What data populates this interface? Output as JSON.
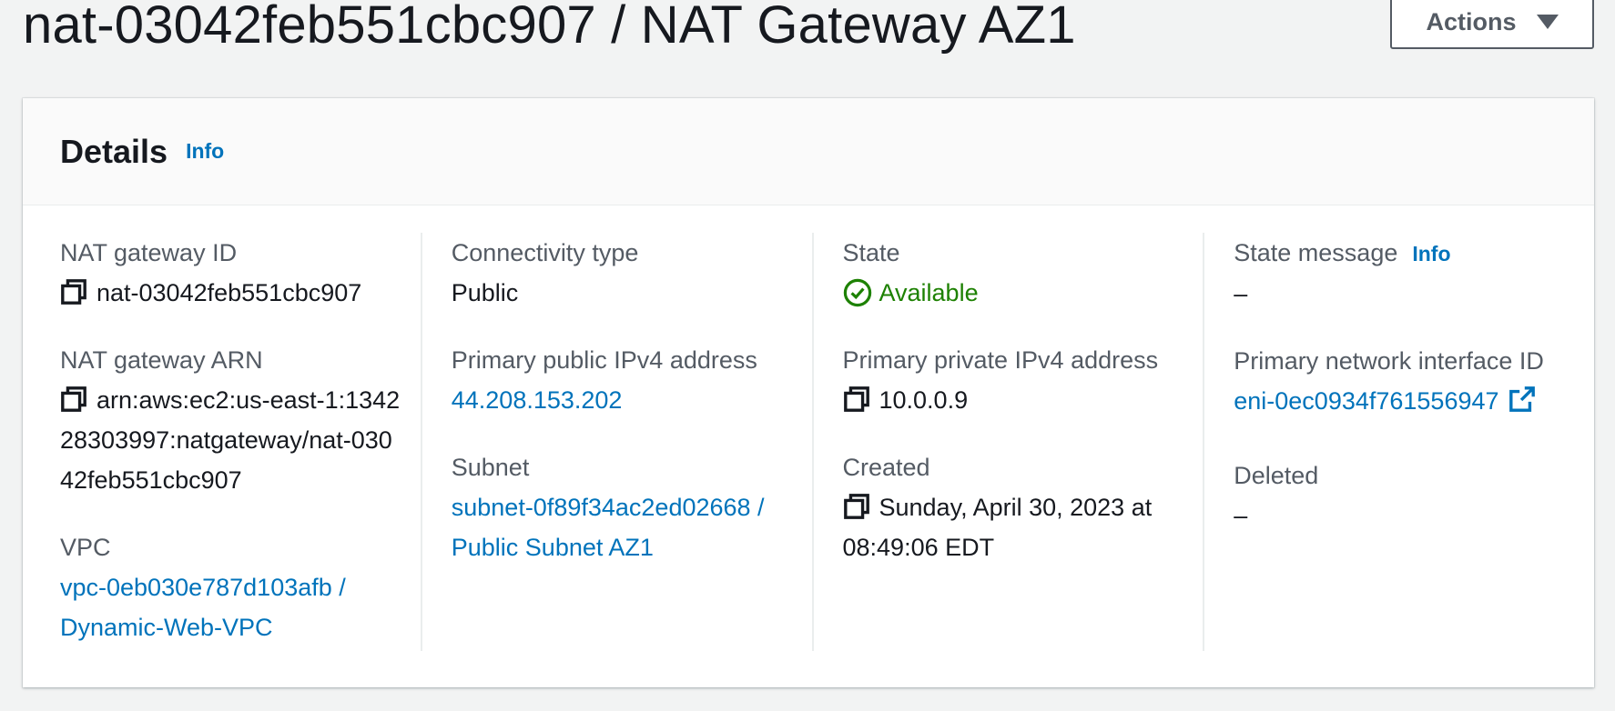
{
  "header": {
    "title": "nat-03042feb551cbc907 / NAT Gateway AZ1",
    "actions_label": "Actions"
  },
  "details": {
    "title": "Details",
    "info": "Info",
    "columns": [
      {
        "fields": [
          {
            "label": "NAT gateway ID",
            "value": "nat-03042feb551cbc907"
          },
          {
            "label": "NAT gateway ARN",
            "value": "arn:aws:ec2:us-east-1:134228303997:natgateway/nat-03042feb551cbc907"
          },
          {
            "label": "VPC",
            "value": "vpc-0eb030e787d103afb / Dynamic-Web-VPC"
          }
        ]
      },
      {
        "fields": [
          {
            "label": "Connectivity type",
            "value": "Public"
          },
          {
            "label": "Primary public IPv4 address",
            "value": "44.208.153.202"
          },
          {
            "label": "Subnet",
            "value": "subnet-0f89f34ac2ed02668 / Public Subnet AZ1"
          }
        ]
      },
      {
        "fields": [
          {
            "label": "State",
            "value": "Available"
          },
          {
            "label": "Primary private IPv4 address",
            "value": "10.0.0.9"
          },
          {
            "label": "Created",
            "value": "Sunday, April 30, 2023 at 08:49:06 EDT"
          }
        ]
      },
      {
        "fields": [
          {
            "label": "State message",
            "info": "Info",
            "value": "–"
          },
          {
            "label": "Primary network interface ID",
            "value": "eni-0ec0934f761556947"
          },
          {
            "label": "Deleted",
            "value": "–"
          }
        ]
      }
    ]
  },
  "colors": {
    "link": "#0073bb",
    "success": "#1d8102",
    "label": "#545b64",
    "text": "#16191f"
  },
  "icons": {
    "copy": "copy-icon",
    "status": "check-circle-icon",
    "external": "external-link-icon",
    "caret": "caret-down-icon"
  }
}
